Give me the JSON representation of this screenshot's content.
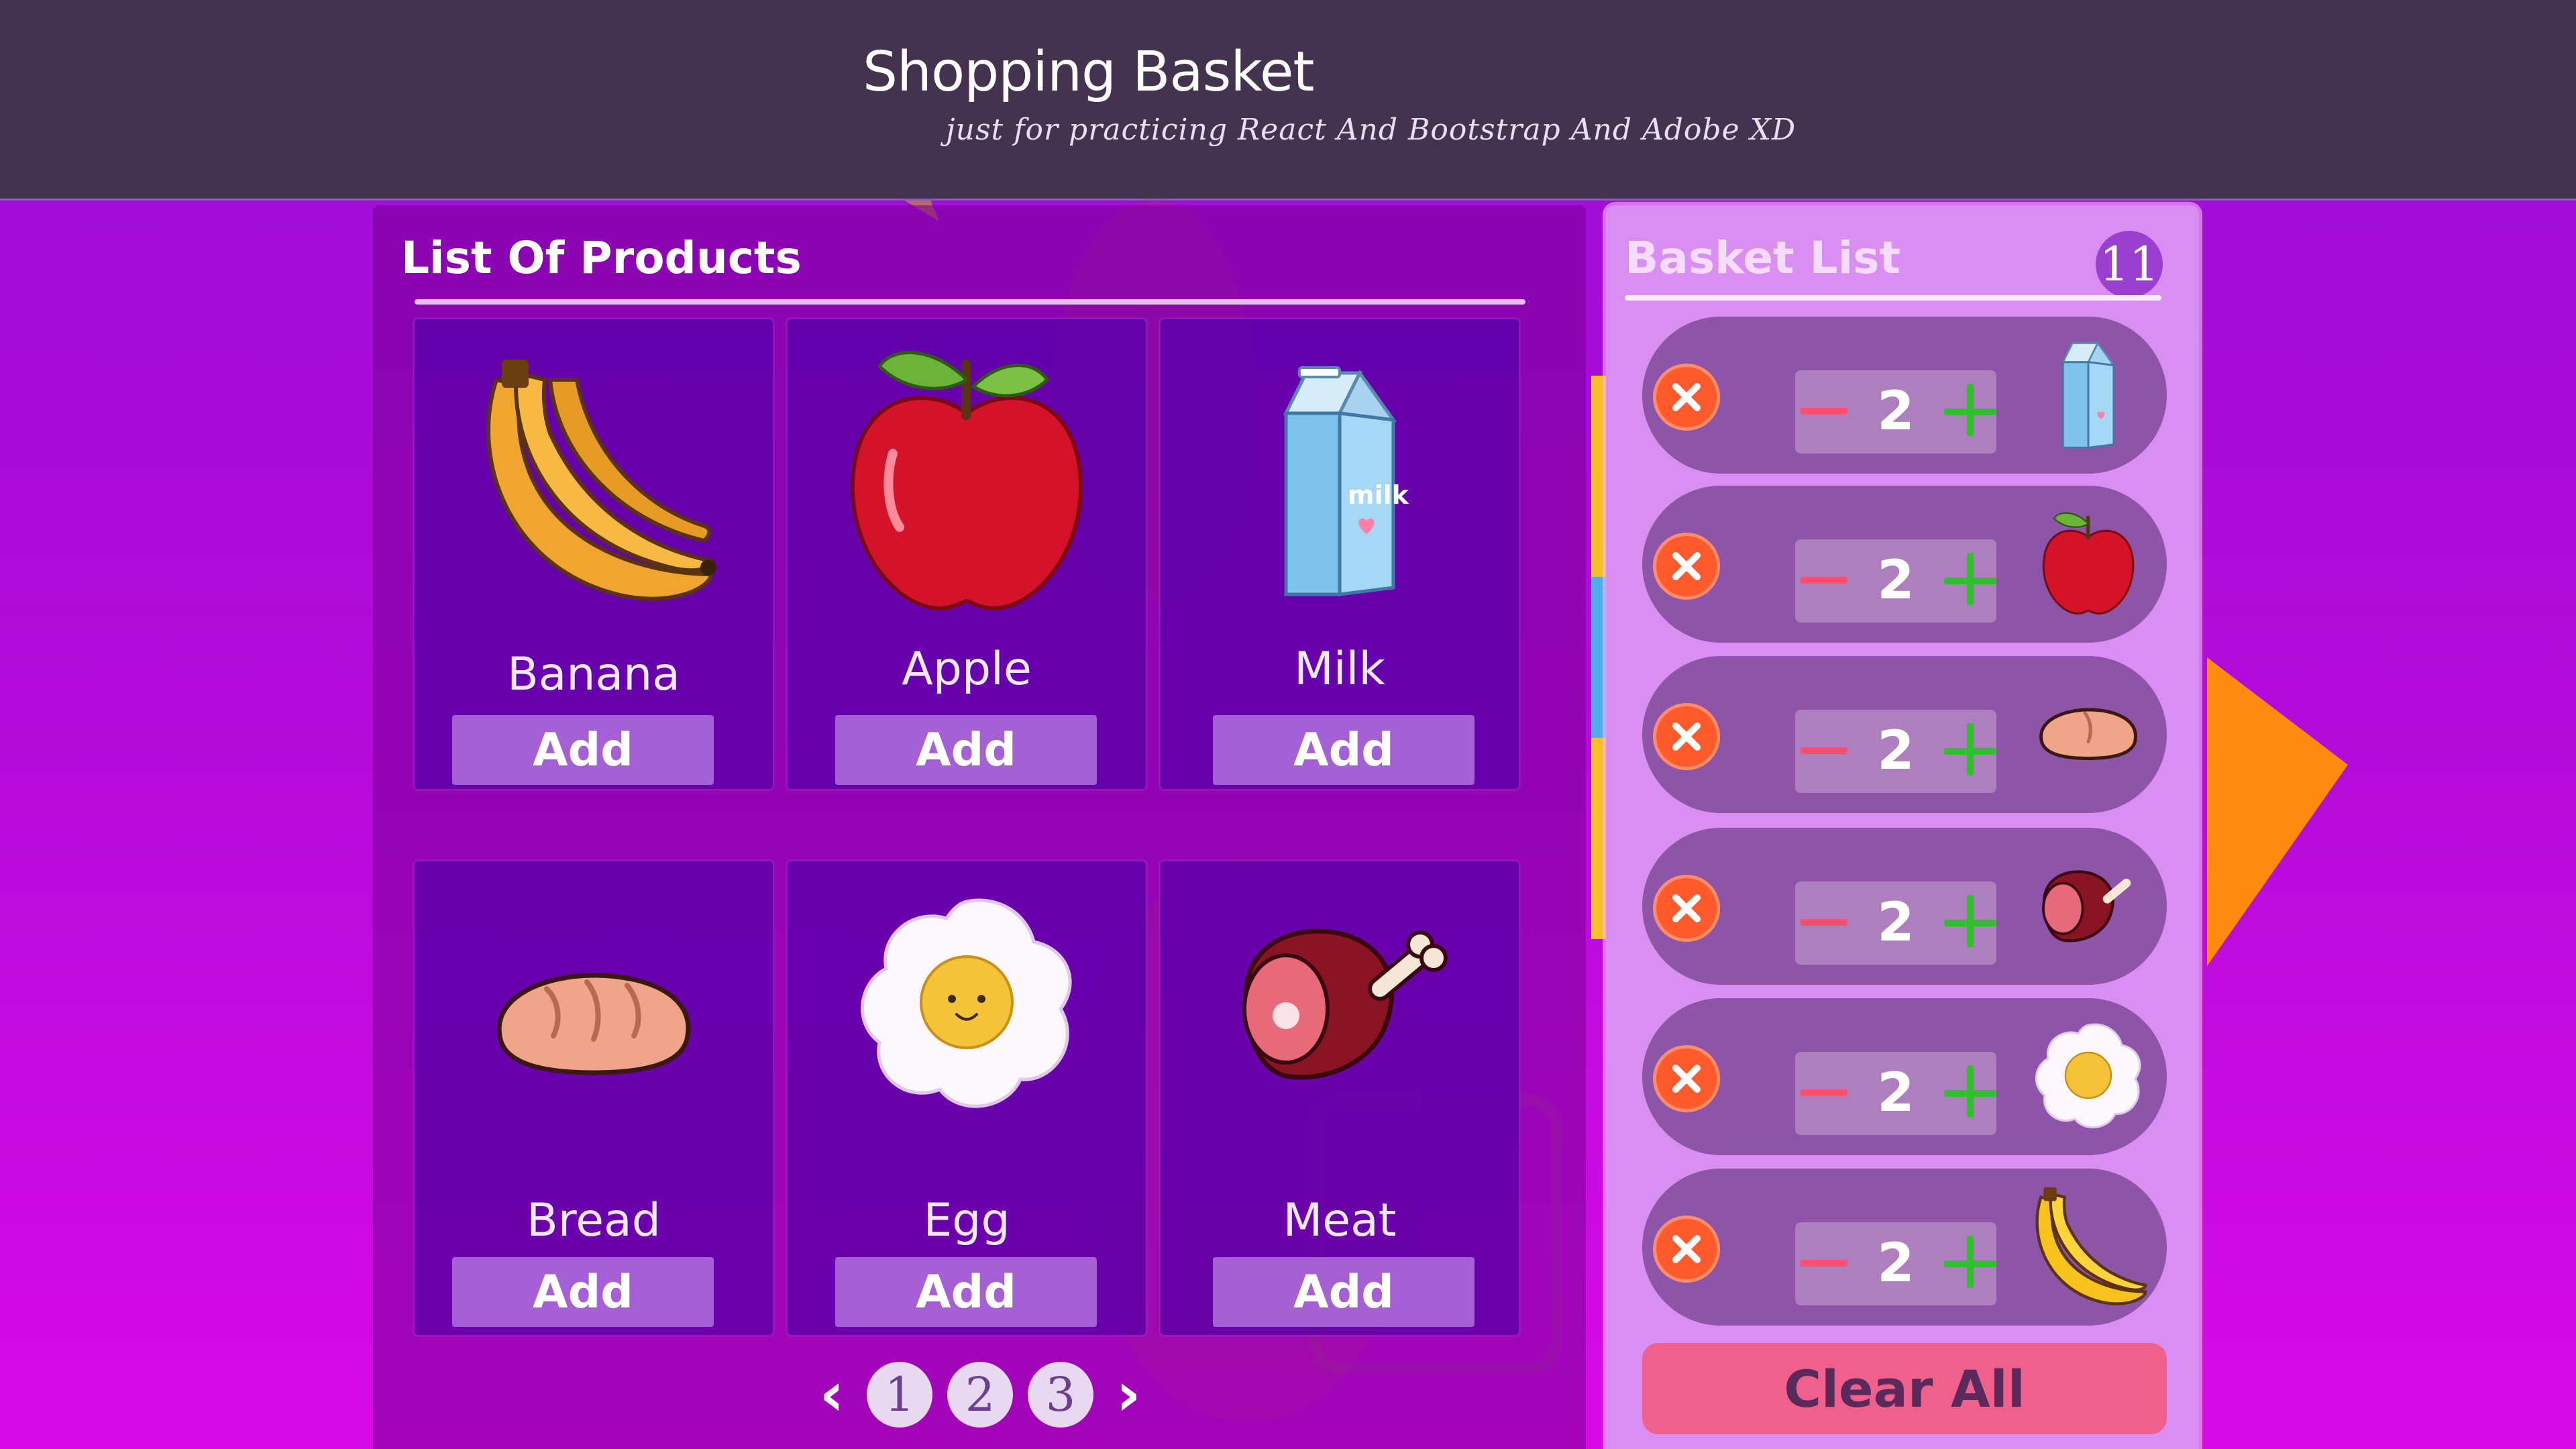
{
  "header": {
    "title": "Shopping Basket",
    "subtitle": "just for practicing React And Bootstrap And Adobe XD"
  },
  "products": {
    "heading": "List Of Products",
    "items": [
      {
        "name": "Banana",
        "add_label": "Add",
        "icon": "banana-icon"
      },
      {
        "name": "Apple",
        "add_label": "Add",
        "icon": "apple-icon"
      },
      {
        "name": "Milk",
        "add_label": "Add",
        "icon": "milk-icon"
      },
      {
        "name": "Bread",
        "add_label": "Add",
        "icon": "bread-icon"
      },
      {
        "name": "Egg",
        "add_label": "Add",
        "icon": "egg-icon"
      },
      {
        "name": "Meat",
        "add_label": "Add",
        "icon": "meat-icon"
      }
    ],
    "pagination": {
      "prev_icon": "chevron-left-icon",
      "pages": [
        "1",
        "2",
        "3"
      ],
      "next_icon": "chevron-right-icon"
    }
  },
  "basket": {
    "heading": "Basket List",
    "count": "11",
    "items": [
      {
        "quantity": "2",
        "icon": "milk-icon"
      },
      {
        "quantity": "2",
        "icon": "apple-icon"
      },
      {
        "quantity": "2",
        "icon": "bread-icon"
      },
      {
        "quantity": "2",
        "icon": "meat-icon"
      },
      {
        "quantity": "2",
        "icon": "egg-icon"
      },
      {
        "quantity": "2",
        "icon": "banana-icon"
      }
    ],
    "clear_label": "Clear All"
  },
  "colors": {
    "header_bg": "#43334f",
    "page_gradient_top": "#9b0ed6",
    "page_gradient_bottom": "#d80be6",
    "card_bg": "#5800aa",
    "basket_panel_bg": "#d98ef2",
    "basket_item_bg": "#8e54a8",
    "remove_red": "#ff5a2c",
    "plus_green": "#2fbf2f",
    "minus_red": "#ff4d6d",
    "clear_pink": "#f0608c",
    "count_badge": "#9a3fd0"
  }
}
